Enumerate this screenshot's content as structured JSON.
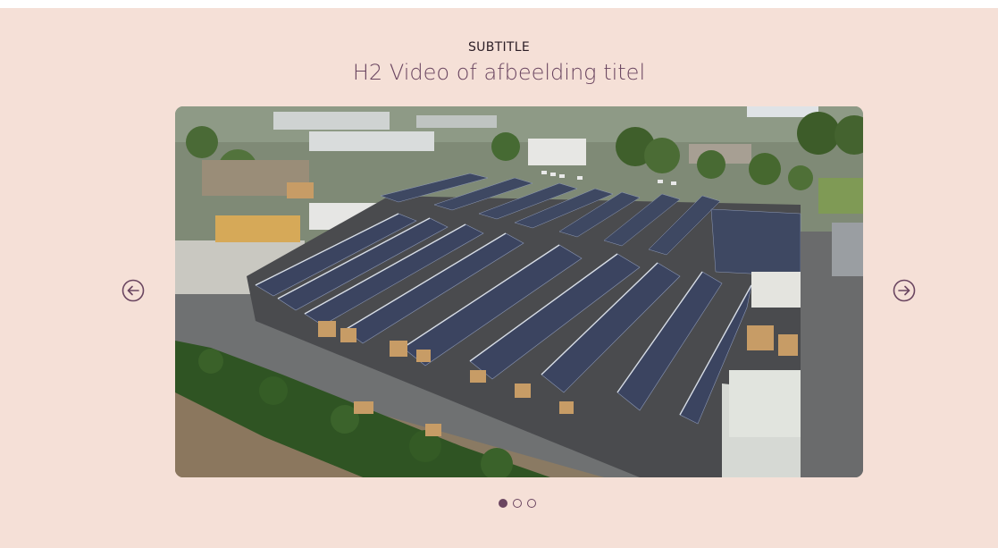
{
  "section": {
    "subtitle": "SUBTITLE",
    "title": "H2 Video of afbeelding titel"
  },
  "carousel": {
    "image_alt": "Aerial photo of industrial building with solar panels",
    "prev_icon": "arrow-left-circle-icon",
    "next_icon": "arrow-right-circle-icon",
    "slide_count": 3,
    "active_slide": 1
  },
  "colors": {
    "background": "#f5e0d7",
    "accent": "#6a4560",
    "subtitle_text": "#2b1d25"
  }
}
